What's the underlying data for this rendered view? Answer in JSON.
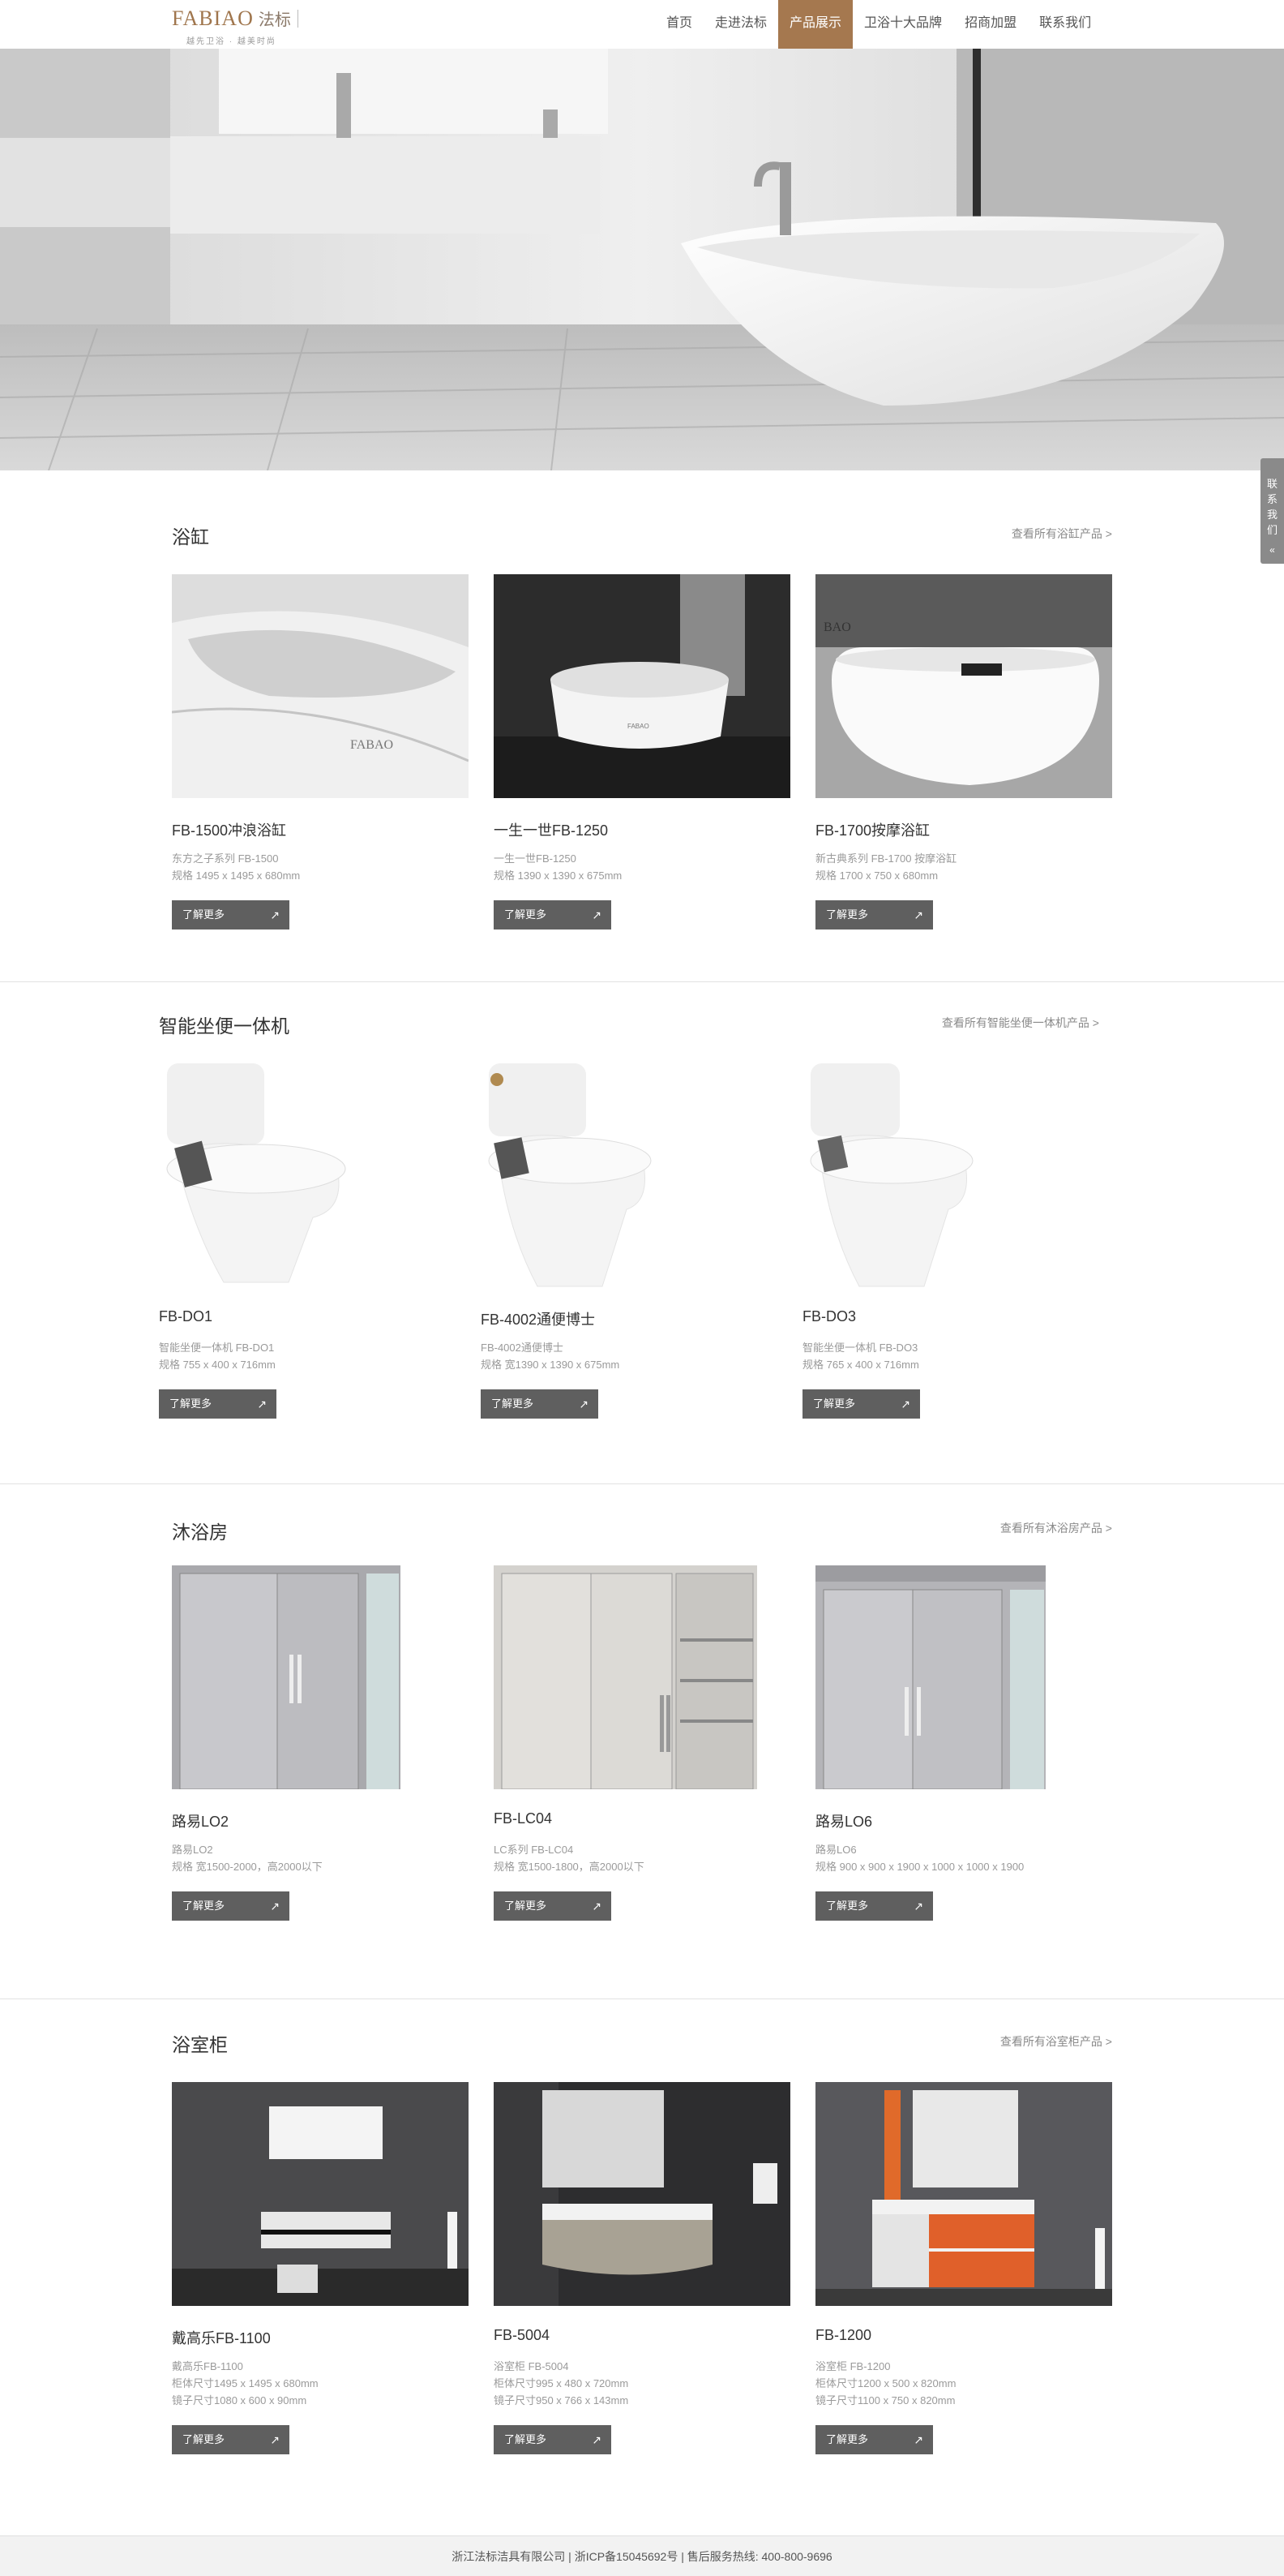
{
  "header": {
    "logo_text": "FABIAO",
    "logo_cn": "法标",
    "logo_tagline": "越先卫浴 · 越美时尚",
    "nav": [
      {
        "label": "首页",
        "active": false
      },
      {
        "label": "走进法标",
        "active": false
      },
      {
        "label": "产品展示",
        "active": true
      },
      {
        "label": "卫浴十大品牌",
        "active": false
      },
      {
        "label": "招商加盟",
        "active": false
      },
      {
        "label": "联系我们",
        "active": false
      }
    ]
  },
  "side_tab": {
    "label": "联系我们",
    "arrow": "«"
  },
  "button_label": "了解更多",
  "button_arrow": "↗",
  "sections": [
    {
      "title": "浴缸",
      "more": "查看所有浴缸产品 >",
      "products": [
        {
          "name": "FB-1500冲浪浴缸",
          "desc": [
            "东方之子系列 FB-1500",
            "规格 1495 x 1495 x 680mm"
          ]
        },
        {
          "name": "一生一世FB-1250",
          "desc": [
            "一生一世FB-1250",
            "规格 1390 x 1390 x 675mm"
          ]
        },
        {
          "name": "FB-1700按摩浴缸",
          "desc": [
            "新古典系列 FB-1700 按摩浴缸",
            "规格 1700 x 750 x 680mm"
          ]
        }
      ]
    },
    {
      "title": "智能坐便一体机",
      "more": "查看所有智能坐便一体机产品 >",
      "products": [
        {
          "name": "FB-DO1",
          "desc": [
            "智能坐便一体机 FB-DO1",
            "规格 755 x 400 x 716mm"
          ]
        },
        {
          "name": "FB-4002通便博士",
          "desc": [
            "FB-4002通便博士",
            "规格 宽1390 x 1390 x 675mm"
          ]
        },
        {
          "name": "FB-DO3",
          "desc": [
            "智能坐便一体机 FB-DO3",
            "规格 765 x 400 x 716mm"
          ]
        }
      ]
    },
    {
      "title": "沐浴房",
      "more": "查看所有沐浴房产品 >",
      "products": [
        {
          "name": "路易LO2",
          "desc": [
            "路易LO2",
            "规格 宽1500-2000，高2000以下"
          ]
        },
        {
          "name": "FB-LC04",
          "desc": [
            "LC系列 FB-LC04",
            "规格 宽1500-1800，高2000以下"
          ]
        },
        {
          "name": "路易LO6",
          "desc": [
            "路易LO6",
            "规格 900 x 900 x 1900 x 1000 x 1000 x 1900"
          ]
        }
      ]
    },
    {
      "title": "浴室柜",
      "more": "查看所有浴室柜产品 >",
      "products": [
        {
          "name": "戴高乐FB-1100",
          "desc": [
            "戴高乐FB-1100",
            "柜体尺寸1495 x 1495 x 680mm",
            "镜子尺寸1080 x 600 x 90mm"
          ]
        },
        {
          "name": "FB-5004",
          "desc": [
            "浴室柜 FB-5004",
            "柜体尺寸995 x 480 x 720mm",
            "镜子尺寸950 x 766 x 143mm"
          ]
        },
        {
          "name": "FB-1200",
          "desc": [
            "浴室柜 FB-1200",
            "柜体尺寸1200 x 500 x 820mm",
            "镜子尺寸1100 x 750 x 820mm"
          ]
        }
      ]
    }
  ],
  "footer": {
    "text": "浙江法标洁具有限公司 | 浙ICP备15045692号 | 售后服务热线: 400-800-9696"
  },
  "colors": {
    "accent": "#a5784f",
    "button": "#5f5f5f",
    "text": "#333333"
  }
}
